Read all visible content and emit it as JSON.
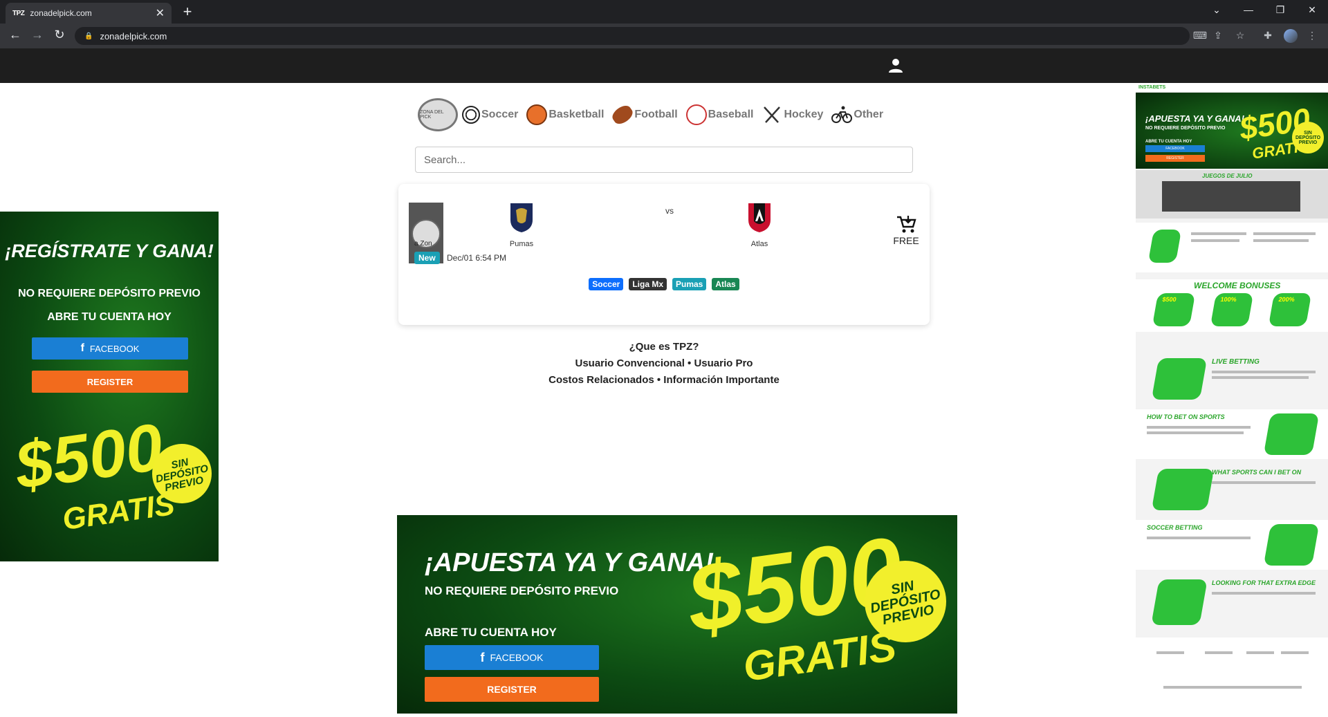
{
  "browser": {
    "tab_favicon": "TPZ",
    "tab_title": "zonadelpick.com",
    "tab_close": "✕",
    "new_tab": "+",
    "url": "zonadelpick.com"
  },
  "nav": {
    "sports": [
      {
        "label": "Soccer",
        "icon": "soccer-ball-icon"
      },
      {
        "label": "Basketball",
        "icon": "basketball-icon"
      },
      {
        "label": "Football",
        "icon": "football-icon"
      },
      {
        "label": "Baseball",
        "icon": "baseball-icon"
      },
      {
        "label": "Hockey",
        "icon": "hockey-sticks-icon"
      },
      {
        "label": "Other",
        "icon": "bicycle-icon"
      }
    ]
  },
  "search": {
    "placeholder": "Search..."
  },
  "match": {
    "badge": "New",
    "thumb_label": "a Zon",
    "date": "Dec/01 6:54 PM",
    "home": "Pumas",
    "vs": "vs",
    "away": "Atlas",
    "price": "FREE",
    "tags": [
      "Soccer",
      "Liga Mx",
      "Pumas",
      "Atlas"
    ]
  },
  "links": {
    "line1": "¿Que es TPZ?",
    "line2": "Usuario Convencional • Usuario Pro",
    "line3": "Costos Relacionados • Información Importante"
  },
  "ad_left": {
    "title": "¡REGÍSTRATE Y GANA!",
    "sub1": "NO REQUIERE DEPÓSITO PREVIO",
    "sub2": "ABRE TU CUENTA HOY",
    "facebook": "FACEBOOK",
    "register": "REGISTER",
    "amount": "$500",
    "gratis": "GRATIS",
    "badge": "SIN DEPÓSITO PREVIO"
  },
  "ad_bottom": {
    "title": "¡APUESTA YA Y GANA!",
    "sub1": "NO REQUIERE DEPÓSITO PREVIO",
    "sub2": "ABRE TU CUENTA HOY",
    "facebook": "FACEBOOK",
    "register": "REGISTER",
    "amount": "$500",
    "gratis": "GRATIS",
    "badge": "SIN DEPÓSITO PREVIO"
  },
  "ad_right": {
    "brand": "INSTABETS",
    "hero_title": "¡APUESTA YA Y GANA!",
    "hero_sub": "NO REQUIERE DEPÓSITO PREVIO",
    "hero_sub2": "ABRE TU CUENTA HOY",
    "facebook": "FACEBOOK",
    "register": "REGISTER",
    "amount": "$500",
    "gratis": "GRATIS",
    "badge": "SIN DEPÓSITO PREVIO",
    "juegos": "JUEGOS DE JULIO",
    "welcome": "WELCOME BONUSES",
    "bonus1": "$500",
    "bonus2": "100%",
    "bonus3": "200%",
    "live": "LIVE BETTING",
    "how": "HOW TO BET ON SPORTS",
    "what": "WHAT SPORTS CAN I BET ON",
    "soccer": "SOCCER BETTING",
    "edge": "LOOKING FOR THAT EXTRA EDGE"
  },
  "colors": {
    "site_header": "#1e1e1e",
    "tag_blue": "#0d6efd",
    "tag_teal": "#1aa0b5",
    "tag_green": "#198754",
    "ad_green": "#0c4a12",
    "ad_yellow": "#f0f02a",
    "register_orange": "#f26b1d",
    "facebook_blue": "#1a7fd4"
  }
}
